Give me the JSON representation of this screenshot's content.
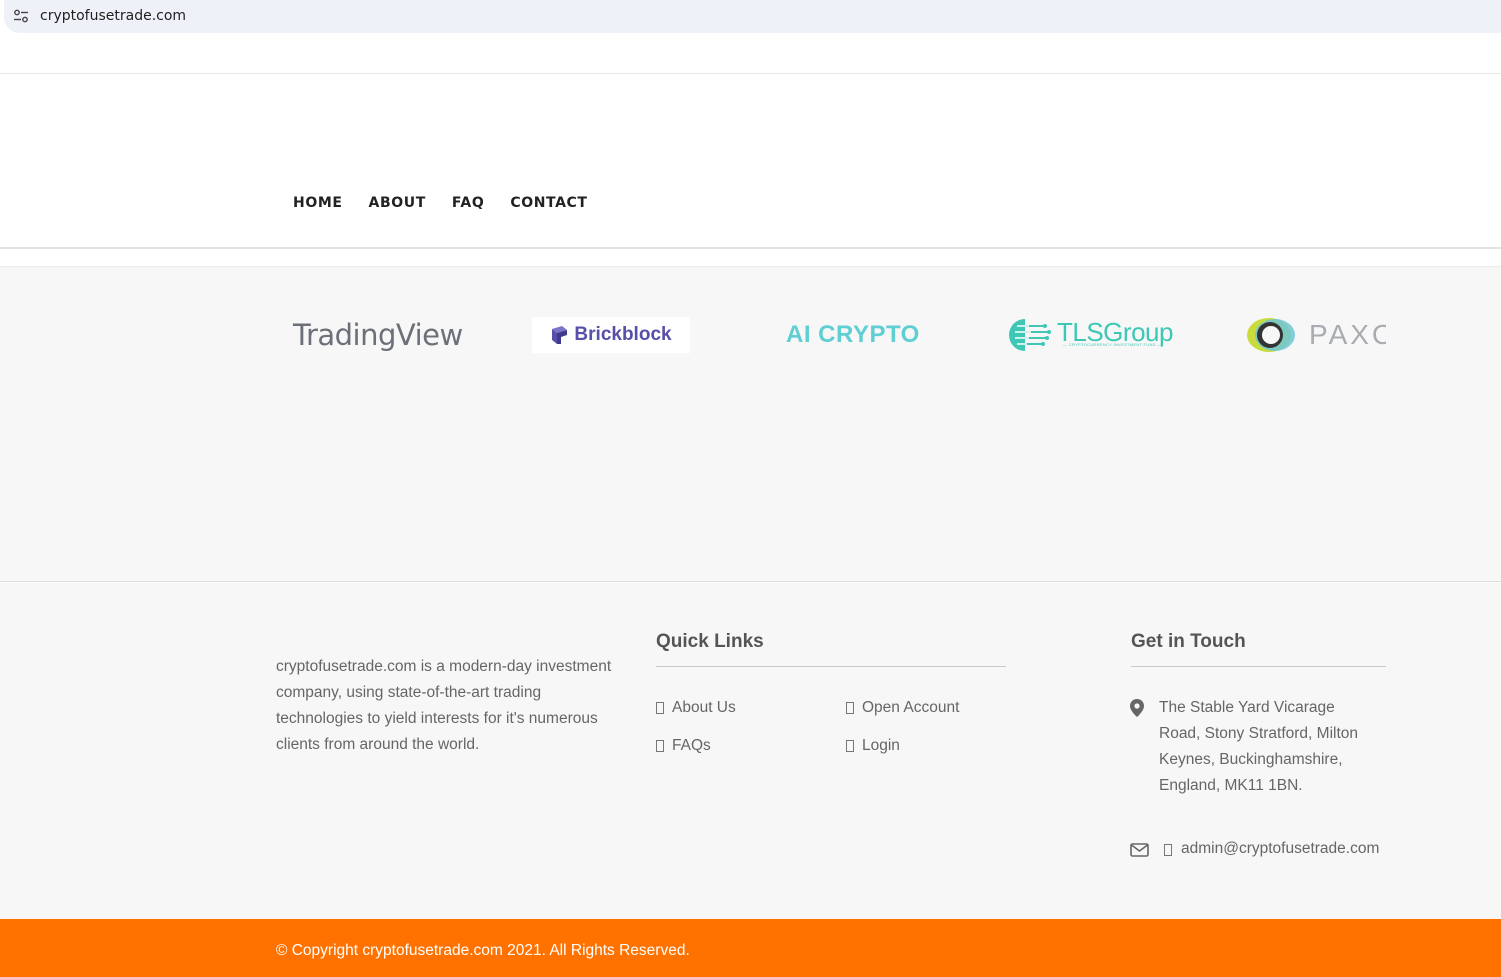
{
  "browser": {
    "url": "cryptofusetrade.com"
  },
  "nav": {
    "items": [
      "HOME",
      "ABOUT",
      "FAQ",
      "CONTACT"
    ]
  },
  "partners": {
    "tradingview": "TradingView",
    "brickblock": "Brickblock",
    "aicrypto": "AI CRYPTO",
    "tlsgroup": "TLSGroup",
    "tlsgroup_sub": "— CRYPTOCURRENCY INVESTMENT FUND —",
    "paxo": "PAXOS"
  },
  "footer": {
    "about": "cryptofusetrade.com is a modern-day investment company, using state-of-the-art trading technologies to yield interests for it's numerous clients from around the world.",
    "quick_links_title": "Quick Links",
    "quick_links": [
      "About Us",
      "Open Account",
      "FAQs",
      "Login"
    ],
    "get_in_touch_title": "Get in Touch",
    "address": "The Stable Yard Vicarage Road, Stony Stratford, Milton Keynes, Buckinghamshire, England, MK11 1BN.",
    "email": "admin@cryptofusetrade.com"
  },
  "copyright": "© Copyright cryptofusetrade.com 2021. All Rights Reserved.",
  "colors": {
    "accent_orange": "#ff7200",
    "footer_bg": "#f7f7f7",
    "brickblock_purple": "#5650a8",
    "aicrypto_cyan": "#5fcfd4",
    "tls_teal": "#3ec7b5"
  }
}
